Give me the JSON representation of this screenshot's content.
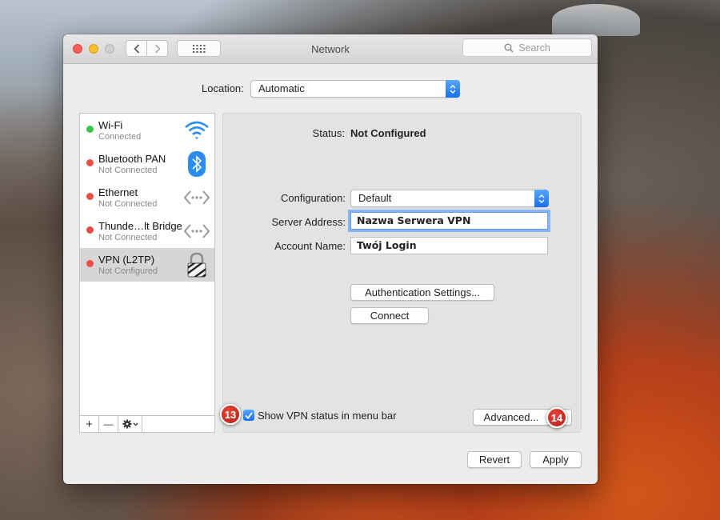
{
  "window": {
    "title": "Network"
  },
  "search": {
    "placeholder": "Search"
  },
  "location": {
    "label": "Location:",
    "value": "Automatic"
  },
  "services": [
    {
      "name": "Wi-Fi",
      "status": "Connected",
      "status_color": "#39c54a",
      "icon": "wifi-icon"
    },
    {
      "name": "Bluetooth PAN",
      "status": "Not Connected",
      "status_color": "#ec4c46",
      "icon": "bluetooth-icon"
    },
    {
      "name": "Ethernet",
      "status": "Not Connected",
      "status_color": "#ec4c46",
      "icon": "ethernet-icon"
    },
    {
      "name": "Thunde…lt Bridge",
      "status": "Not Connected",
      "status_color": "#ec4c46",
      "icon": "thunderbolt-bridge-icon"
    },
    {
      "name": "VPN (L2TP)",
      "status": "Not Configured",
      "status_color": "#ec4c46",
      "icon": "vpn-lock-icon",
      "selected": true
    }
  ],
  "sidebar_footer": {
    "add": "+",
    "remove": "—"
  },
  "detail": {
    "status_label": "Status:",
    "status_value": "Not Configured",
    "configuration_label": "Configuration:",
    "configuration_value": "Default",
    "server_label": "Server Address:",
    "server_value": "Nazwa Serwera VPN",
    "account_label": "Account Name:",
    "account_value": "Twój Login",
    "auth_button": "Authentication Settings...",
    "connect_button": "Connect",
    "show_vpn_label": "Show VPN status in menu bar",
    "show_vpn_checked": true,
    "advanced_button": "Advanced..."
  },
  "annotations": {
    "badge_13": "13",
    "badge_14": "14"
  },
  "footer": {
    "revert_button": "Revert",
    "apply_button": "Apply"
  },
  "colors": {
    "accent": "#1671ec",
    "badge": "#c5251c"
  }
}
